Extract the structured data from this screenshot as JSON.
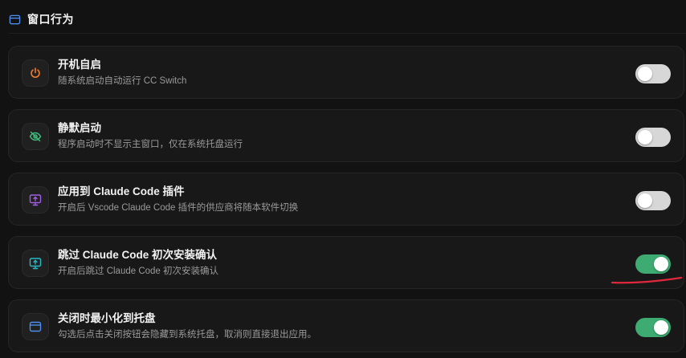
{
  "section": {
    "title": "窗口行为",
    "icon": "window-icon"
  },
  "colors": {
    "accent_on": "#3dab72",
    "toggle_off": "#d7d7d7",
    "annotation": "#e0283c"
  },
  "settings": [
    {
      "title": "开机自启",
      "desc": "随系统启动自动运行 CC Switch",
      "icon": "power-icon",
      "icon_color": "#f07a2d",
      "enabled": false
    },
    {
      "title": "静默启动",
      "desc": "程序启动时不显示主窗口，仅在系统托盘运行",
      "icon": "eye-off-icon",
      "icon_color": "#3fba7c",
      "enabled": false
    },
    {
      "title": "应用到 Claude Code 插件",
      "desc": "开启后 Vscode Claude Code 插件的供应商将随本软件切换",
      "icon": "monitor-upload-icon",
      "icon_color": "#a35ee0",
      "enabled": false
    },
    {
      "title": "跳过 Claude Code 初次安装确认",
      "desc": "开启后跳过 Claude Code 初次安装确认",
      "icon": "monitor-upload-icon",
      "icon_color": "#28b8c6",
      "enabled": true
    },
    {
      "title": "关闭时最小化到托盘",
      "desc": "勾选后点击关闭按钮会隐藏到系统托盘，取消则直接退出应用。",
      "icon": "window-icon",
      "icon_color": "#4c8ff0",
      "enabled": true
    }
  ]
}
